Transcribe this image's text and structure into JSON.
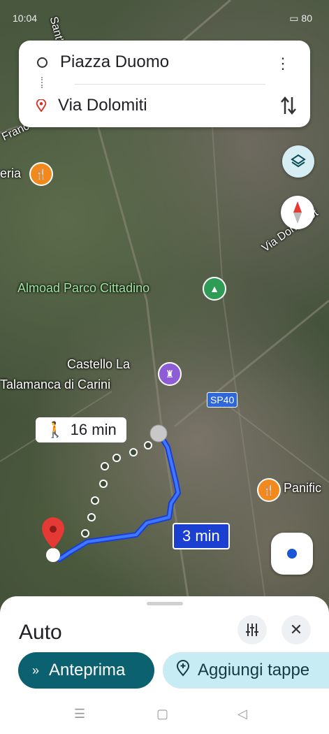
{
  "status_bar": {
    "time": "10:04",
    "battery": "80"
  },
  "route": {
    "origin": "Piazza Duomo",
    "destination": "Via Dolomiti"
  },
  "map": {
    "labels": {
      "park": "Almoad Parco Cittadino",
      "castle_line1": "Castello La",
      "castle_line2": "Talamanca di Carini",
      "road_sp40": "SP40",
      "street": "Via Don L. St",
      "shop": "Panific",
      "restaurant": "eria",
      "road_top": "Sant'A",
      "road_left": "Franc"
    },
    "walk_time": "16 min",
    "drive_time": "3 min"
  },
  "sheet": {
    "mode": "Auto",
    "preview_label": "Anteprima",
    "add_stops_label": "Aggiungi tappe"
  },
  "icons": {
    "more": "more-vert-icon",
    "swap": "swap-icon",
    "layers": "layers-icon",
    "compass": "compass-icon",
    "locate": "my-location-icon",
    "filter": "tune-icon",
    "close": "close-icon"
  }
}
